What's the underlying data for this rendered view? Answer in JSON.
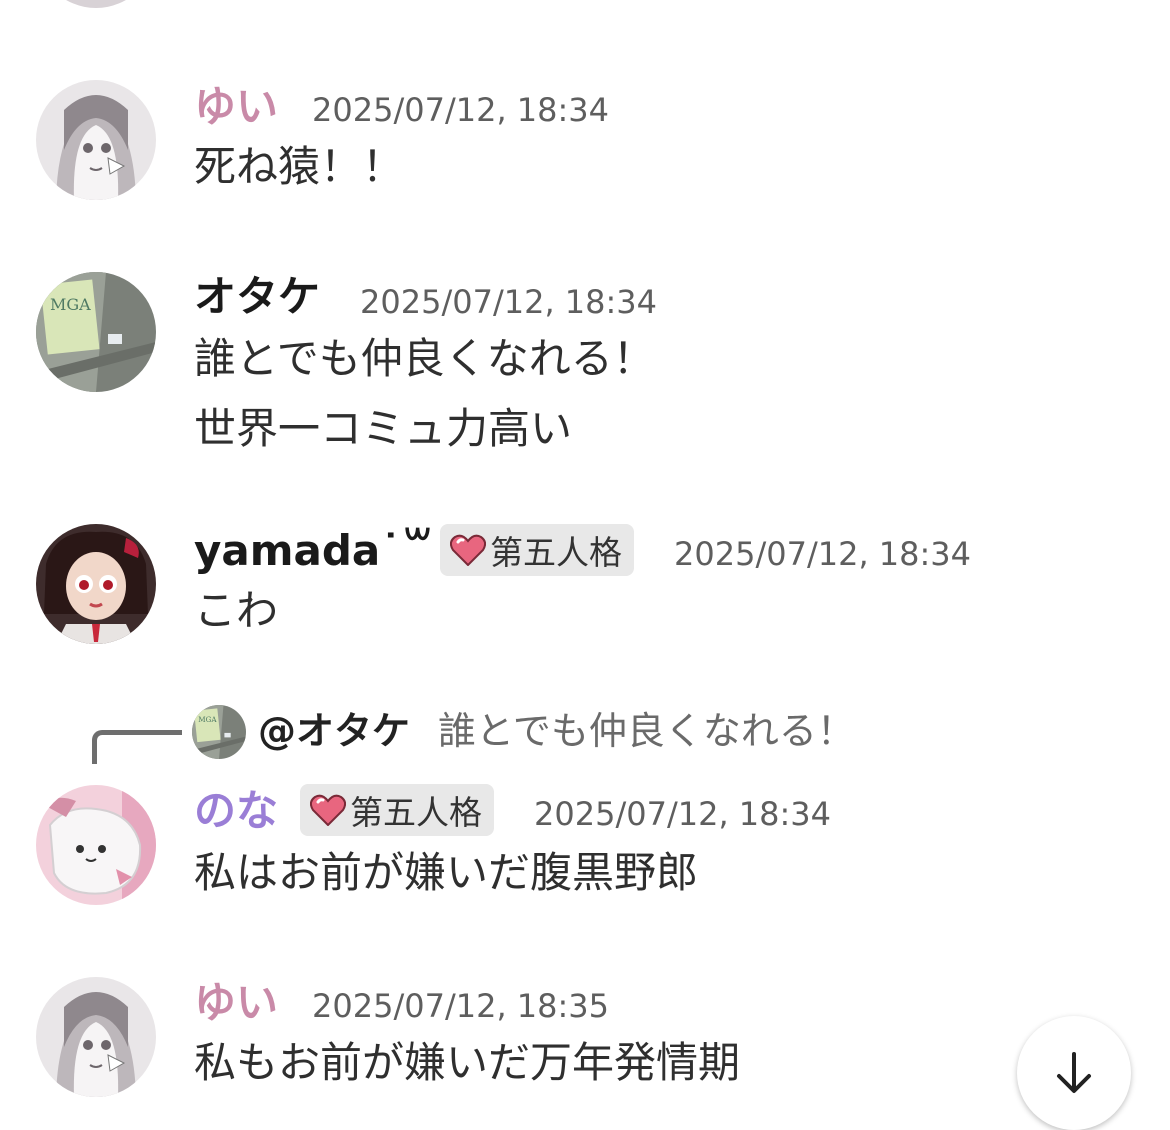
{
  "colors": {
    "name_pink": "#c98aa8",
    "name_black": "#1a1a1a",
    "name_purple": "#9a7ed6",
    "badge_bg": "#e8e8e8",
    "timestamp": "#5e5e5e"
  },
  "messages": [
    {
      "author": "ゆい",
      "timestamp": "2025/07/12, 18:34",
      "lines": [
        "死ね猿！！"
      ],
      "avatar_icon": "user-avatar-gray-sketch"
    },
    {
      "author": "オタケ",
      "timestamp": "2025/07/12, 18:34",
      "lines": [
        "誰とでも仲良くなれる！",
        "世界一コミュ力高い"
      ],
      "avatar_icon": "user-avatar-poster"
    },
    {
      "author": "yamada˙꒳˙",
      "badge": "第五人格",
      "timestamp": "2025/07/12, 18:34",
      "lines": [
        "こわ"
      ],
      "avatar_icon": "user-avatar-game-character"
    },
    {
      "author": "のな",
      "badge": "第五人格",
      "timestamp": "2025/07/12, 18:34",
      "lines": [
        "私はお前が嫌いだ腹黒野郎"
      ],
      "avatar_icon": "user-avatar-pink-plush",
      "reply": {
        "name": "@オタケ",
        "text": "誰とでも仲良くなれる！"
      }
    },
    {
      "author": "ゆい",
      "timestamp": "2025/07/12, 18:35",
      "lines": [
        "私もお前が嫌いだ万年発情期"
      ],
      "avatar_icon": "user-avatar-gray-sketch"
    }
  ],
  "scroll_button_icon": "arrow-down-icon"
}
